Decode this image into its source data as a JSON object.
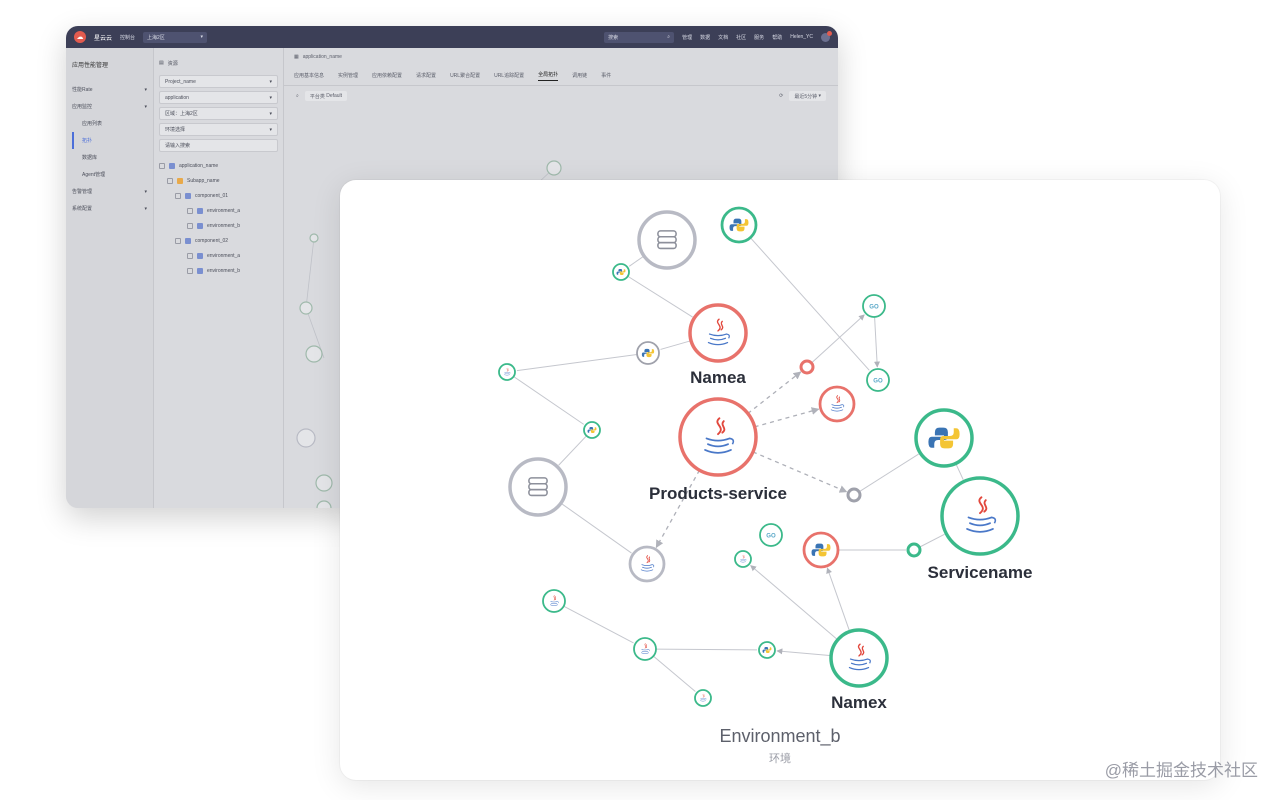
{
  "background_app": {
    "brand": "星云云",
    "top_select": "上海2区",
    "top_left_link": "控制台",
    "search_placeholder": "搜索",
    "nav": [
      "管理",
      "数据",
      "文档",
      "社区",
      "服务",
      "帮助"
    ],
    "user": "Helen_YC",
    "sidebar_title": "应用性能管理",
    "sidebar_items": [
      {
        "label": "性能Rate",
        "sub": false
      },
      {
        "label": "应用监控",
        "sub": false
      },
      {
        "label": "应用列表",
        "sub": true
      },
      {
        "label": "拓扑",
        "sub": true,
        "active": true
      },
      {
        "label": "数据库",
        "sub": true
      },
      {
        "label": "Agent管理",
        "sub": true
      },
      {
        "label": "告警管理",
        "sub": false
      },
      {
        "label": "系统配置",
        "sub": false
      }
    ],
    "tree_header": "资源",
    "project_select": "Project_name",
    "app_select": "application",
    "region_select": "区域：上海2区",
    "env_select": "环境选择",
    "tree_search_placeholder": "请输入搜索",
    "tree_nodes": [
      "application_name",
      "Subapp_name",
      "component_01",
      "environment_a",
      "environment_b",
      "component_02",
      "environment_a",
      "environment_b"
    ],
    "breadcrumb": "application_name",
    "tabs": [
      "应用基本信息",
      "实例管理",
      "应用依赖配置",
      "请求配置",
      "URL聚合配置",
      "URL追踪配置",
      "全局拓扑",
      "调用链",
      "事件"
    ],
    "active_tab": "全局拓扑",
    "filter_label": "平台类",
    "filter_value": "Default",
    "range_select": "最近5分钟"
  },
  "topology": {
    "environment_title": "Environment_b",
    "environment_subtitle": "环境",
    "nodes": [
      {
        "id": "db1",
        "type": "database",
        "color": "#b8bac4",
        "size": "large",
        "label": ""
      },
      {
        "id": "py_top",
        "type": "python",
        "color": "#3bb98a",
        "size": "medium",
        "label": ""
      },
      {
        "id": "py_tiny1",
        "type": "python",
        "color": "#3bb98a",
        "size": "tiny",
        "label": ""
      },
      {
        "id": "namea",
        "type": "java",
        "color": "#e8726b",
        "size": "large",
        "label": "Namea"
      },
      {
        "id": "go1",
        "type": "go",
        "color": "#3bb98a",
        "size": "small",
        "label": ""
      },
      {
        "id": "go2",
        "type": "go",
        "color": "#3bb98a",
        "size": "small",
        "label": ""
      },
      {
        "id": "py_gray",
        "type": "python",
        "color": "#9fa1ab",
        "size": "small",
        "label": ""
      },
      {
        "id": "java_tiny_left",
        "type": "java",
        "color": "#3bb98a",
        "size": "tiny",
        "label": ""
      },
      {
        "id": "red_dot",
        "type": "dot",
        "color": "#e8726b",
        "size": "dot",
        "label": ""
      },
      {
        "id": "java_red_small",
        "type": "java",
        "color": "#e8726b",
        "size": "medium",
        "label": ""
      },
      {
        "id": "products",
        "type": "java",
        "color": "#e8726b",
        "size": "xlarge",
        "label": "Products-service"
      },
      {
        "id": "py_small_mid",
        "type": "python",
        "color": "#3bb98a",
        "size": "tiny",
        "label": ""
      },
      {
        "id": "db2",
        "type": "database",
        "color": "#b8bac4",
        "size": "large",
        "label": ""
      },
      {
        "id": "py_big_right",
        "type": "python",
        "color": "#3bb98a",
        "size": "large",
        "label": ""
      },
      {
        "id": "gray_dot",
        "type": "dot",
        "color": "#9fa1ab",
        "size": "dot",
        "label": ""
      },
      {
        "id": "servicename",
        "type": "java",
        "color": "#3bb98a",
        "size": "xlarge",
        "label": "Servicename"
      },
      {
        "id": "java_gray",
        "type": "java",
        "color": "#b8bac4",
        "size": "medium",
        "label": ""
      },
      {
        "id": "go3",
        "type": "go",
        "color": "#3bb98a",
        "size": "small",
        "label": ""
      },
      {
        "id": "java_tiny_mid",
        "type": "java",
        "color": "#3bb98a",
        "size": "tiny",
        "label": ""
      },
      {
        "id": "py_red",
        "type": "python",
        "color": "#e8726b",
        "size": "medium",
        "label": ""
      },
      {
        "id": "green_dot",
        "type": "dot",
        "color": "#3bb98a",
        "size": "dot",
        "label": ""
      },
      {
        "id": "java_small_bl",
        "type": "java",
        "color": "#3bb98a",
        "size": "small",
        "label": ""
      },
      {
        "id": "java_small_b",
        "type": "java",
        "color": "#3bb98a",
        "size": "small",
        "label": ""
      },
      {
        "id": "py_tiny_b",
        "type": "python",
        "color": "#3bb98a",
        "size": "tiny",
        "label": ""
      },
      {
        "id": "java_tiny_b",
        "type": "java",
        "color": "#3bb98a",
        "size": "tiny",
        "label": ""
      },
      {
        "id": "namex",
        "type": "java",
        "color": "#3bb98a",
        "size": "large",
        "label": "Namex"
      }
    ],
    "edges": [
      [
        "db1",
        "py_tiny1",
        "solid"
      ],
      [
        "py_tiny1",
        "namea",
        "solid"
      ],
      [
        "py_top",
        "go2",
        "solid"
      ],
      [
        "go1",
        "go2",
        "arrow"
      ],
      [
        "namea",
        "py_gray",
        "solid"
      ],
      [
        "py_gray",
        "java_tiny_left",
        "solid"
      ],
      [
        "java_tiny_left",
        "py_small_mid",
        "solid"
      ],
      [
        "red_dot",
        "go1",
        "arrow"
      ],
      [
        "products",
        "red_dot",
        "dashed"
      ],
      [
        "products",
        "java_red_small",
        "dashed"
      ],
      [
        "products",
        "gray_dot",
        "dashed"
      ],
      [
        "products",
        "java_gray",
        "dashed"
      ],
      [
        "py_small_mid",
        "db2",
        "solid"
      ],
      [
        "db2",
        "java_gray",
        "solid"
      ],
      [
        "gray_dot",
        "py_big_right",
        "solid"
      ],
      [
        "py_big_right",
        "servicename",
        "solid"
      ],
      [
        "py_red",
        "green_dot",
        "solid"
      ],
      [
        "green_dot",
        "servicename",
        "solid"
      ],
      [
        "namex",
        "py_red",
        "arrow"
      ],
      [
        "namex",
        "java_tiny_mid",
        "arrow"
      ],
      [
        "namex",
        "py_tiny_b",
        "arrow"
      ],
      [
        "java_small_bl",
        "java_small_b",
        "solid"
      ],
      [
        "java_small_b",
        "py_tiny_b",
        "solid"
      ],
      [
        "java_small_b",
        "java_tiny_b",
        "solid"
      ]
    ]
  },
  "watermark": "@稀土掘金技术社区"
}
